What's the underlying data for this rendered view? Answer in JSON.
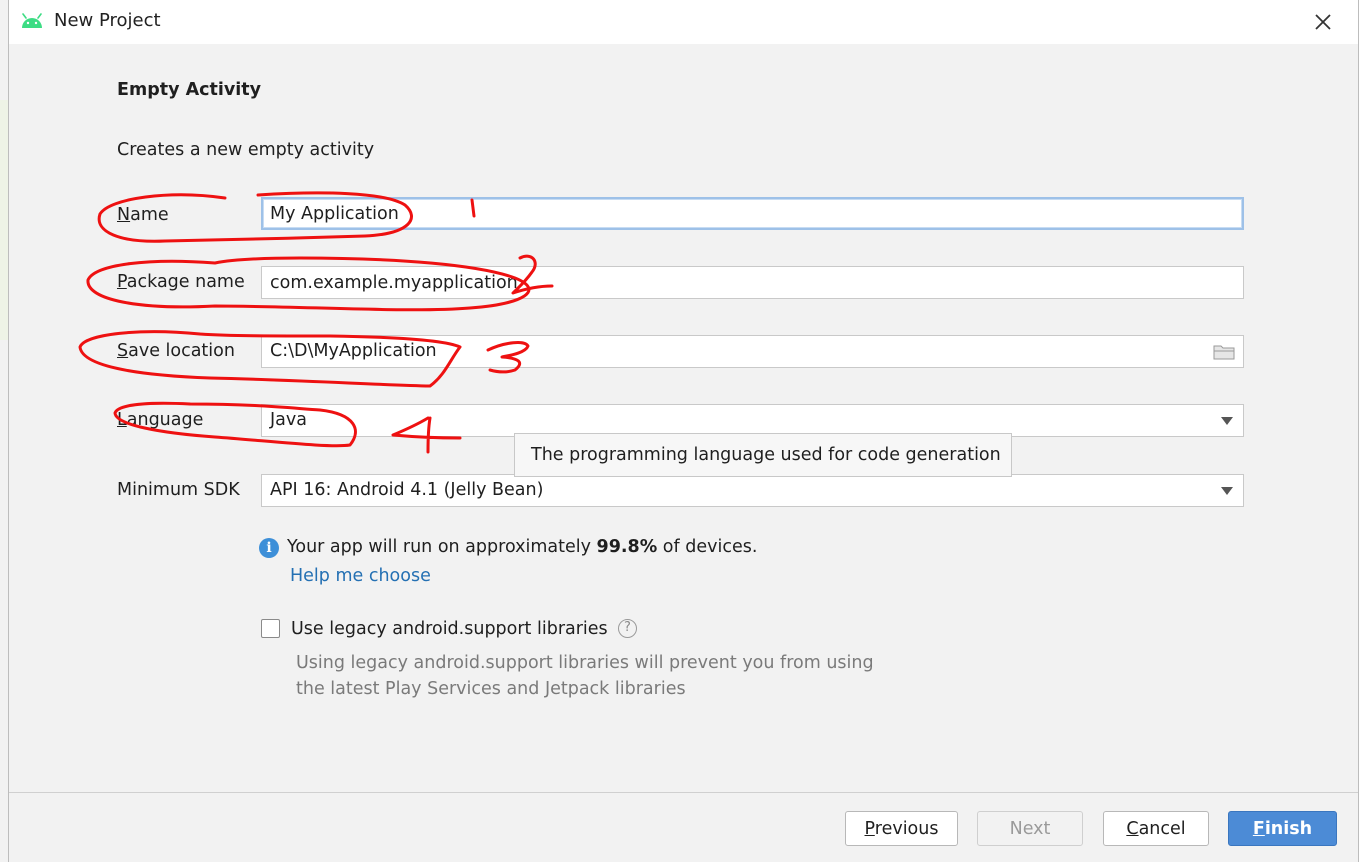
{
  "window": {
    "title": "New Project"
  },
  "template": {
    "heading": "Empty Activity",
    "description": "Creates a new empty activity"
  },
  "form": {
    "name": {
      "label_first": "N",
      "label_rest": "ame",
      "value": "My Application"
    },
    "package": {
      "label_first": "P",
      "label_rest": "ackage name",
      "value": "com.example.myapplication"
    },
    "location": {
      "label_first": "S",
      "label_rest": "ave location",
      "value": "C:\\D\\MyApplication"
    },
    "language": {
      "label_first": "L",
      "label_rest": "anguage",
      "value": "Java"
    },
    "min_sdk": {
      "label": "Minimum SDK",
      "value": "API 16: Android 4.1 (Jelly Bean)"
    }
  },
  "tooltip": "The programming language used for code generation",
  "info": {
    "prefix": "Your app will run on approximately ",
    "percent": "99.8%",
    "suffix": " of devices.",
    "help_link": "Help me choose"
  },
  "legacy": {
    "label": "Use legacy android.support libraries",
    "checked": false,
    "desc_line1": "Using legacy android.support libraries will prevent you from using",
    "desc_line2": "the latest Play Services and Jetpack libraries"
  },
  "buttons": {
    "previous_first": "P",
    "previous_rest": "revious",
    "next": "Next",
    "cancel_first": "C",
    "cancel_rest": "ancel",
    "finish_first": "F",
    "finish_rest": "inish"
  },
  "annotations": [
    "1",
    "2",
    "3",
    "4"
  ],
  "colors": {
    "accent": "#4c8bd6",
    "link": "#2470b3",
    "annotation": "#ee1111",
    "android": "#3ddc84"
  }
}
